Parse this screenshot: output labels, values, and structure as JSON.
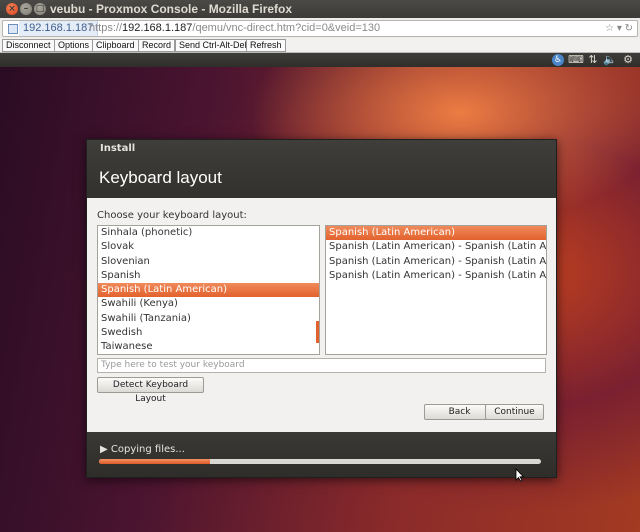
{
  "window": {
    "title": "veubu - Proxmox Console - Mozilla Firefox",
    "close_glyph": "×",
    "min_glyph": "–",
    "max_glyph": "□"
  },
  "urlbar": {
    "host_badge": "192.168.1.187",
    "url_prefix": "https://",
    "url_host": "192.168.1.187",
    "url_path": "/qemu/vnc-direct.htm?cid=0&veid=130",
    "icons": "☆ ▾ ↻"
  },
  "vnc_toolbar": {
    "buttons": [
      "Disconnect",
      "Options",
      "Clipboard",
      "Record",
      "Send Ctrl-Alt-Del",
      "Refresh"
    ]
  },
  "ubuntu_panel": {
    "icons": [
      {
        "name": "accessibility-icon",
        "glyph": "♿"
      },
      {
        "name": "keyboard-icon",
        "glyph": "⌨"
      },
      {
        "name": "network-icon",
        "glyph": "⇅"
      },
      {
        "name": "volume-icon",
        "glyph": "🔈"
      },
      {
        "name": "settings-gear-icon",
        "glyph": "⚙"
      }
    ]
  },
  "installer": {
    "caption": "Install",
    "title": "Keyboard layout",
    "choose_label": "Choose your keyboard layout:",
    "layouts": [
      "Sinhala (phonetic)",
      "Slovak",
      "Slovenian",
      "Spanish",
      "Spanish (Latin American)",
      "Swahili (Kenya)",
      "Swahili (Tanzania)",
      "Swedish",
      "Taiwanese"
    ],
    "layouts_selected_index": 4,
    "variants": [
      "Spanish (Latin American)",
      "Spanish (Latin American) - Spanish (Latin American, ",
      "Spanish (Latin American) - Spanish (Latin American, ",
      "Spanish (Latin American) - Spanish (Latin American, "
    ],
    "variants_selected_index": 0,
    "test_placeholder": "Type here to test your keyboard",
    "detect_button": "Detect Keyboard Layout",
    "back_button": "Back",
    "continue_button": "Continue",
    "status": "Copying files...",
    "status_arrow": "▶",
    "progress": 0.25,
    "accent_color": "#e2622e"
  }
}
